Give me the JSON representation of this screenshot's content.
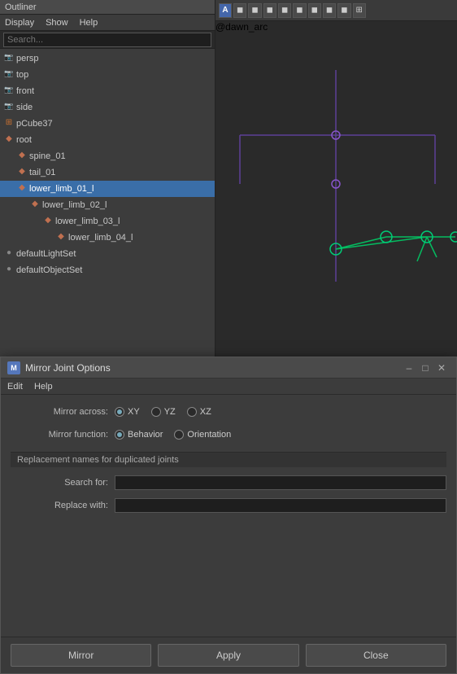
{
  "outliner": {
    "title": "Outliner",
    "menus": [
      "Display",
      "Show",
      "Help"
    ],
    "search_placeholder": "Search...",
    "tree": [
      {
        "id": "persp",
        "label": "persp",
        "type": "camera",
        "indent": 0
      },
      {
        "id": "top",
        "label": "top",
        "type": "camera",
        "indent": 0
      },
      {
        "id": "front",
        "label": "front",
        "type": "camera",
        "indent": 0
      },
      {
        "id": "side",
        "label": "side",
        "type": "camera",
        "indent": 0
      },
      {
        "id": "pCube37",
        "label": "pCube37",
        "type": "cube",
        "indent": 0
      },
      {
        "id": "root",
        "label": "root",
        "type": "joint",
        "indent": 0,
        "expanded": true
      },
      {
        "id": "spine_01",
        "label": "spine_01",
        "type": "joint",
        "indent": 1
      },
      {
        "id": "tail_01",
        "label": "tail_01",
        "type": "joint",
        "indent": 1
      },
      {
        "id": "lower_limb_01_l",
        "label": "lower_limb_01_l",
        "type": "joint",
        "indent": 1,
        "selected": true
      },
      {
        "id": "lower_limb_02_l",
        "label": "lower_limb_02_l",
        "type": "joint",
        "indent": 2
      },
      {
        "id": "lower_limb_03_l",
        "label": "lower_limb_03_l",
        "type": "joint",
        "indent": 3
      },
      {
        "id": "lower_limb_04_l",
        "label": "lower_limb_04_l",
        "type": "joint",
        "indent": 4
      },
      {
        "id": "defaultLightSet",
        "label": "defaultLightSet",
        "type": "set",
        "indent": 0
      },
      {
        "id": "defaultObjectSet",
        "label": "defaultObjectSet",
        "type": "set",
        "indent": 0
      }
    ]
  },
  "viewport": {
    "toolbar_buttons": [
      "A",
      "◀",
      "▶",
      "⏹",
      "⏺",
      "⏩",
      "↗",
      "✦",
      "⊟",
      "▦"
    ],
    "watermark": "@dawn_arc"
  },
  "dialog": {
    "title": "Mirror Joint Options",
    "title_icon": "M",
    "menus": [
      "Edit",
      "Help"
    ],
    "mirror_across_label": "Mirror across:",
    "mirror_across_options": [
      "XY",
      "YZ",
      "XZ"
    ],
    "mirror_across_selected": "XY",
    "mirror_function_label": "Mirror function:",
    "mirror_function_options": [
      "Behavior",
      "Orientation"
    ],
    "mirror_function_selected": "Behavior",
    "replacement_section": "Replacement names for duplicated joints",
    "search_for_label": "Search for:",
    "search_for_value": "",
    "replace_with_label": "Replace with:",
    "replace_with_value": "",
    "buttons": {
      "mirror": "Mirror",
      "apply": "Apply",
      "close": "Close"
    }
  },
  "colors": {
    "accent": "#3a6ea8",
    "dialog_bg": "#3c3c3c",
    "titlebar_bg": "#4a4a4a"
  }
}
